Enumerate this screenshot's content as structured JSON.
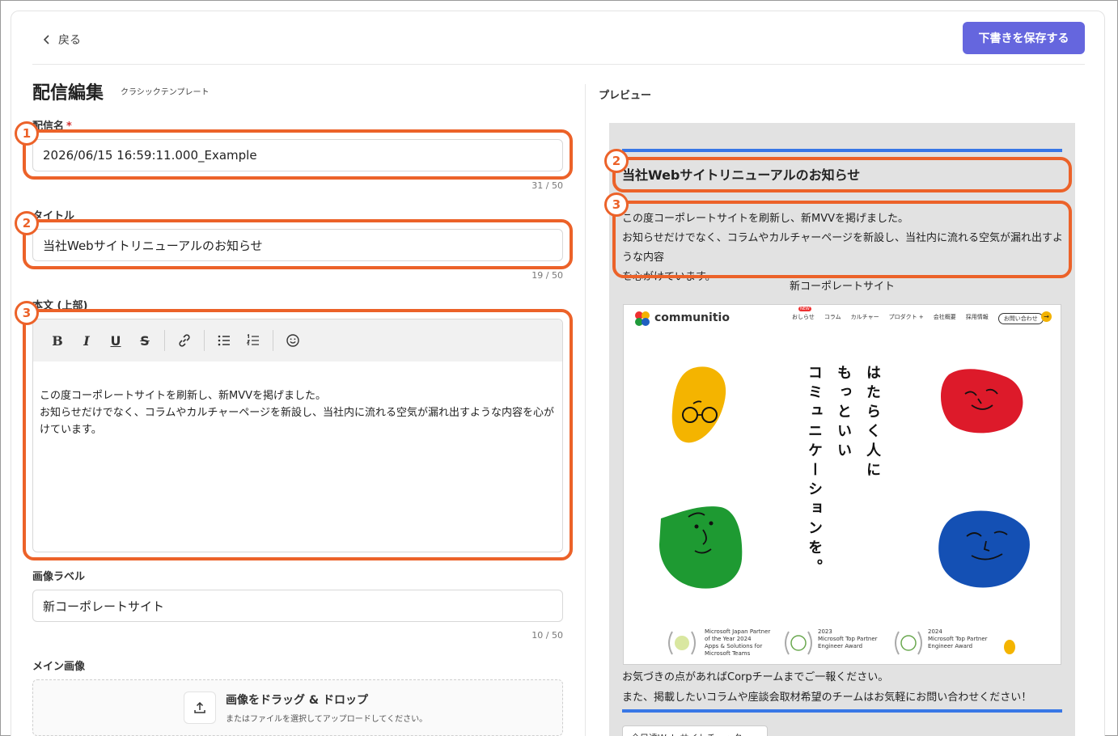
{
  "header": {
    "back_label": "戻る",
    "save_label": "下書きを保存する"
  },
  "form": {
    "page_title": "配信編集",
    "template_tag": "クラシックテンプレート",
    "name": {
      "label": "配信名",
      "required_mark": "*",
      "value": "2026/06/15 16:59:11.000_Example",
      "counter": "31 / 50"
    },
    "title": {
      "label": "タイトル",
      "value": "当社Webサイトリニューアルのお知らせ",
      "counter": "19 / 50"
    },
    "body": {
      "label": "本文 (上部)",
      "lines": [
        "この度コーポレートサイトを刷新し、新MVVを掲げました。",
        "お知らせだけでなく、コラムやカルチャーページを新設し、当社内に流れる空気が漏れ出すような内容を心がけています。"
      ]
    },
    "image_label": {
      "label": "画像ラベル",
      "value": "新コーポレートサイト",
      "counter": "10 / 50"
    },
    "main_image": {
      "label": "メイン画像",
      "drop_title": "画像をドラッグ & ドロップ",
      "drop_sub": "またはファイルを選択してアップロードしてください。"
    }
  },
  "annotations": {
    "badge1": "1",
    "badge2": "2",
    "badge3": "3"
  },
  "preview": {
    "label": "プレビュー",
    "title": "当社Webサイトリニューアルのお知らせ",
    "body_lines": [
      "この度コーポレートサイトを刷新し、新MVVを掲げました。",
      "お知らせだけでなく、コラムやカルチャーページを新設し、当社内に流れる空気が漏れ出すような内容",
      "を心がけています。"
    ],
    "image_label": "新コーポレートサイト",
    "site": {
      "logo": "communitio",
      "nav": [
        "おしらせ",
        "コラム",
        "カルチャー",
        "プロダクト +",
        "会社概要",
        "採用情報"
      ],
      "nav_new": "NEW",
      "contact": "お問い合わせ",
      "tagline_col1": "はたらく人に",
      "tagline_col2": "もっといい",
      "tagline_col3": "コミュニケーションを。",
      "awards": [
        [
          "Microsoft Japan Partner",
          "of the Year 2024",
          "Apps & Solutions for",
          "Microsoft Teams"
        ],
        [
          "2023",
          "Microsoft Top Partner",
          "Engineer Award"
        ],
        [
          "2024",
          "Microsoft Top Partner",
          "Engineer Award"
        ]
      ]
    },
    "footer_line1": "お気づきの点があればCorpチームまでご一報ください。",
    "footer_line2": "また、掲載したいコラムや座談会取材希望のチームはお気軽にお問い合わせください！",
    "button_label": "全目達Web サイトチェック"
  },
  "colors": {
    "accent": "#6566de",
    "highlight": "#ec6229",
    "preview_bar": "#3877e6"
  },
  "icons": {
    "back": "chevron-left-icon",
    "bold": "bold-icon",
    "italic": "italic-icon",
    "underline": "underline-icon",
    "strike": "strikethrough-icon",
    "link": "link-icon",
    "bullets": "bullet-list-icon",
    "numbers": "numbered-list-icon",
    "emoji": "emoji-icon",
    "upload": "upload-icon"
  }
}
